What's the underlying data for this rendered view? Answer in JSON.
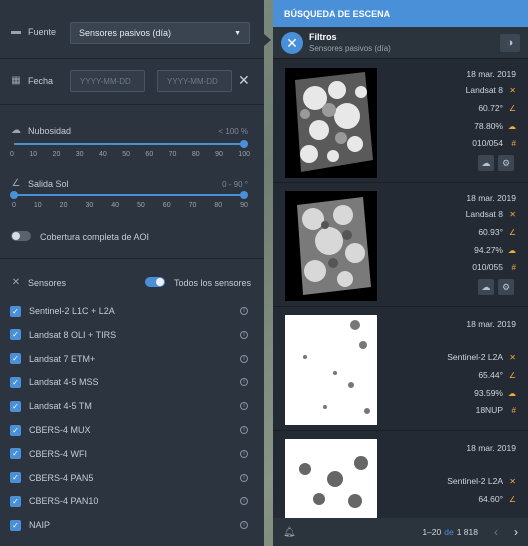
{
  "filters": {
    "source_label": "Fuente",
    "source_value": "Sensores pasivos (día)",
    "date_label": "Fecha",
    "date_from_placeholder": "YYYY-MM-DD",
    "date_to_placeholder": "YYYY-MM-DD",
    "cloud_label": "Nubosidad",
    "cloud_value": "< 100 %",
    "cloud_max_pct": 100,
    "cloud_ticks": [
      "0",
      "10",
      "20",
      "30",
      "40",
      "50",
      "60",
      "70",
      "80",
      "90",
      "100"
    ],
    "sun_label": "Salida Sol",
    "sun_value": "0 - 90 °",
    "sun_ticks": [
      "0",
      "10",
      "20",
      "30",
      "40",
      "50",
      "60",
      "70",
      "80",
      "90"
    ],
    "aoi_label": "Cobertura completa de AOI",
    "sensors_label": "Sensores",
    "all_sensors_label": "Todos los sensores",
    "sensors": [
      "Sentinel-2 L1C + L2A",
      "Landsat 8 OLI + TIRS",
      "Landsat 7 ETM+",
      "Landsat 4-5 MSS",
      "Landsat 4-5 TM",
      "CBERS-4 MUX",
      "CBERS-4 WFI",
      "CBERS-4 PAN5",
      "CBERS-4 PAN10",
      "NAIP"
    ]
  },
  "results": {
    "header": "BÚSQUEDA DE ESCENA",
    "filter_title": "Filtros",
    "filter_subtitle": "Sensores pasivos (día)",
    "scenes": [
      {
        "date": "18 mar. 2019",
        "sensor": "Landsat  8",
        "angle": "60.72°",
        "cloud": "78.80%",
        "tile": "010/054"
      },
      {
        "date": "18 mar. 2019",
        "sensor": "Landsat  8",
        "angle": "60.93°",
        "cloud": "94.27%",
        "tile": "010/055"
      },
      {
        "date": "18 mar. 2019",
        "sensor": "Sentinel-2  L2A",
        "angle": "65.44°",
        "cloud": "93.59%",
        "tile": "18NUP"
      },
      {
        "date": "18 mar. 2019",
        "sensor": "Sentinel-2  L2A",
        "angle": "64.60°",
        "cloud": "",
        "tile": ""
      }
    ],
    "pagination_range": "1–20",
    "pagination_of": "de",
    "pagination_total": "1 818"
  }
}
